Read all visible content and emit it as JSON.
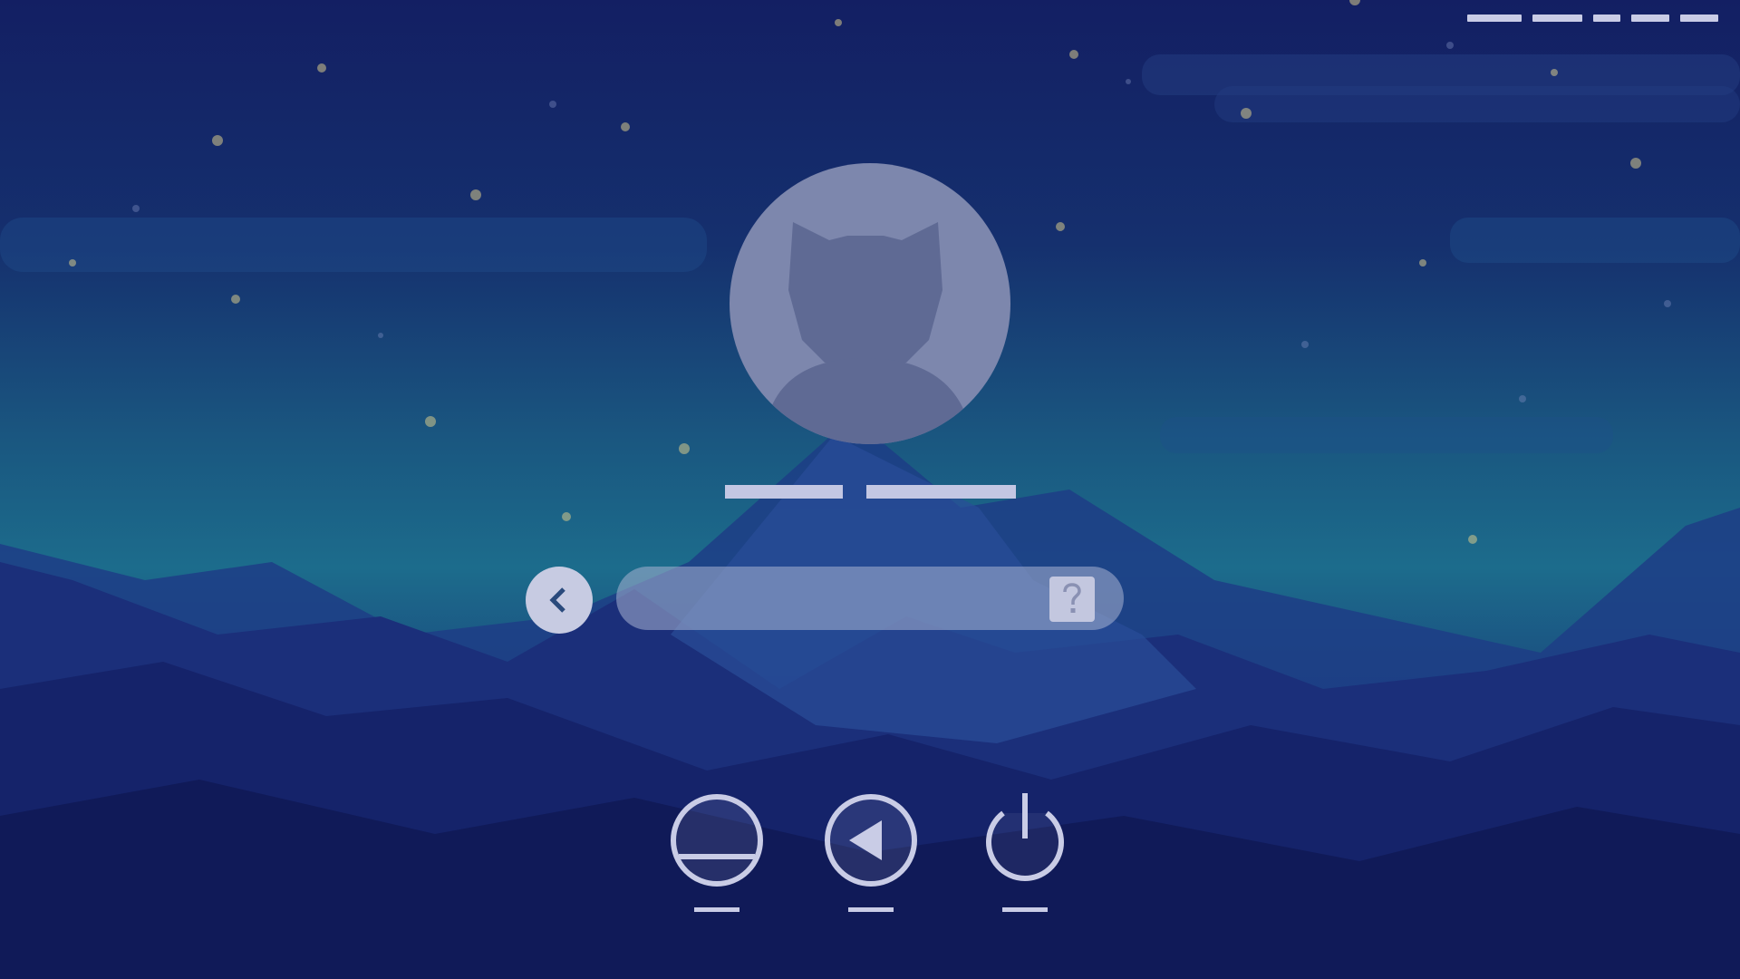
{
  "screen": {
    "type": "login-screen"
  },
  "status_bar": {
    "items": [
      {
        "icon": "status-placeholder-icon"
      },
      {
        "icon": "status-placeholder-icon"
      },
      {
        "icon": "status-placeholder-icon"
      },
      {
        "icon": "status-placeholder-icon"
      },
      {
        "icon": "status-placeholder-icon"
      }
    ]
  },
  "user": {
    "avatar_icon": "cat-user-silhouette-icon",
    "name": ""
  },
  "login": {
    "back_icon": "chevron-left-icon",
    "password_value": "",
    "password_placeholder": "",
    "hint_icon": "question-mark-icon"
  },
  "actions": [
    {
      "id": "sleep",
      "icon": "sleep-icon",
      "label": ""
    },
    {
      "id": "restart",
      "icon": "restart-icon",
      "label": ""
    },
    {
      "id": "shutdown",
      "icon": "power-icon",
      "label": ""
    }
  ],
  "colors": {
    "ui_light": "#c9cce6",
    "avatar_bg": "#7d87ad",
    "avatar_fg": "#5f6a94",
    "field_bg": "#a8b2d2",
    "icon_dark": "#2a4a7c"
  }
}
